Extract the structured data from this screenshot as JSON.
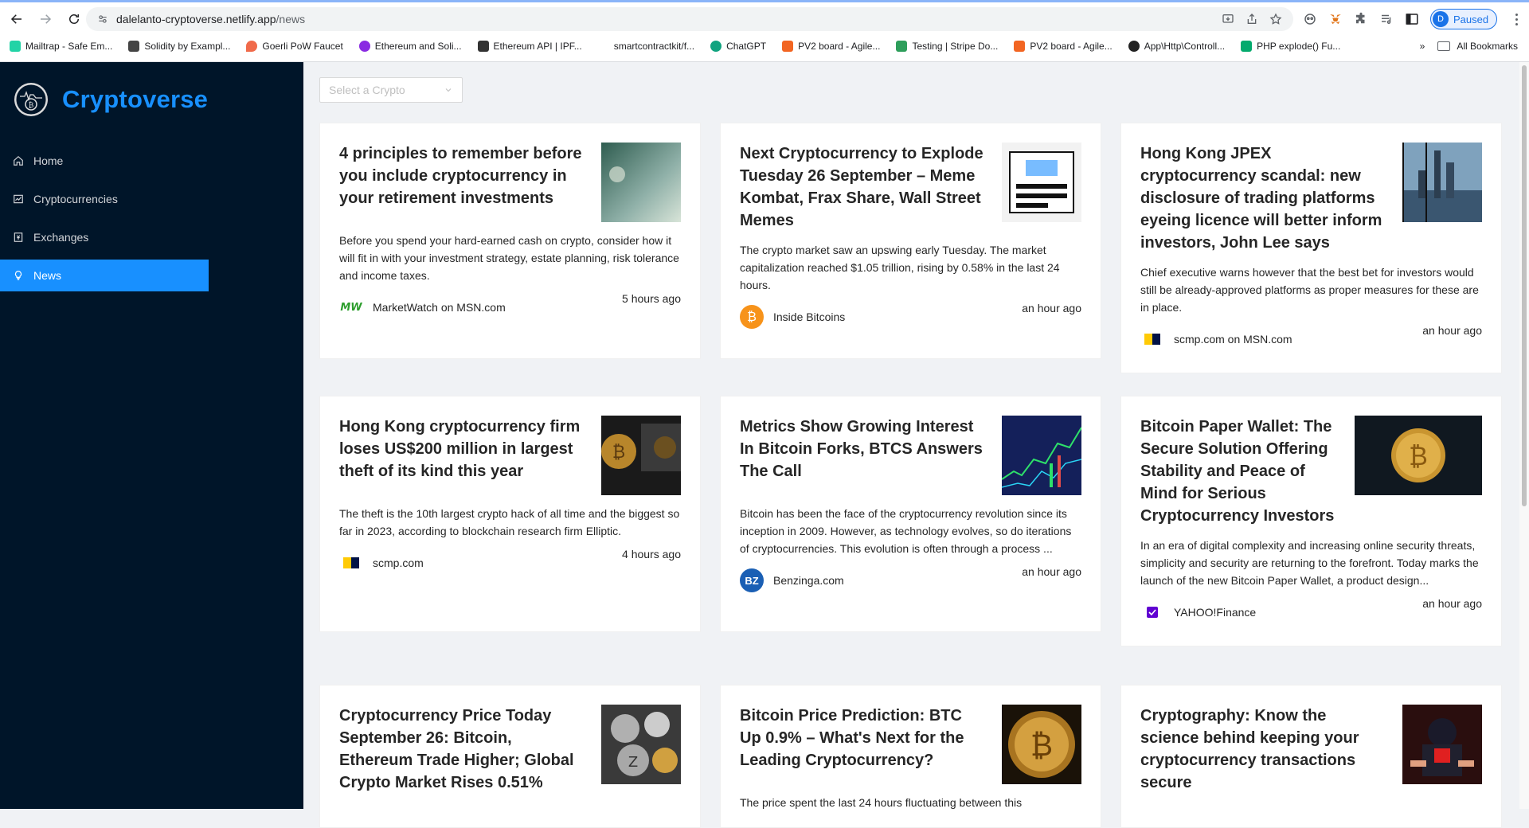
{
  "browser": {
    "url_host": "dalelanto-cryptoverse.netlify.app",
    "url_path": "/news",
    "profile_initial": "D",
    "profile_status": "Paused",
    "bookmarks": [
      {
        "label": "Mailtrap - Safe Em...",
        "color": "#22d3a6"
      },
      {
        "label": "Solidity by Exampl...",
        "color": "#444444"
      },
      {
        "label": "Goerli PoW Faucet",
        "color": "#f06a4a"
      },
      {
        "label": "Ethereum and Soli...",
        "color": "#8a2be2"
      },
      {
        "label": "Ethereum API | IPF...",
        "color": "#333333"
      },
      {
        "label": "smartcontractkit/f...",
        "color": "#ffffff"
      },
      {
        "label": "ChatGPT",
        "color": "#10a37f"
      },
      {
        "label": "PV2 board - Agile...",
        "color": "#f26522"
      },
      {
        "label": "Testing | Stripe Do...",
        "color": "#2e9e5b"
      },
      {
        "label": "PV2 board - Agile...",
        "color": "#f26522"
      },
      {
        "label": "App\\Http\\Controll...",
        "color": "#222222"
      },
      {
        "label": "PHP explode() Fu...",
        "color": "#04aa6d"
      }
    ],
    "all_bookmarks": "All Bookmarks",
    "overflow": "»"
  },
  "app": {
    "title": "Cryptoverse",
    "menu": [
      {
        "label": "Home",
        "icon": "home-icon"
      },
      {
        "label": "Cryptocurrencies",
        "icon": "fund-icon"
      },
      {
        "label": "Exchanges",
        "icon": "money-collect-icon"
      },
      {
        "label": "News",
        "icon": "bulb-icon",
        "active": true
      }
    ],
    "select_placeholder": "Select a Crypto"
  },
  "news": [
    {
      "headline": "4 principles to remember before you include cryptocurrency in your retirement investments",
      "description": "Before you spend your hard-earned cash on crypto, consider how it will fit in with your investment strategy, estate planning, risk tolerance and income taxes.",
      "provider": "MarketWatch on MSN.com",
      "time": "5 hours ago",
      "thumb_color": "#6b8f8c"
    },
    {
      "headline": "Next Cryptocurrency to Explode Tuesday 26 September – Meme Kombat, Frax Share, Wall Street Memes",
      "description": "The crypto market saw an upswing early Tuesday. The market capitalization reached $1.05 trillion, rising by 0.58% in the last 24 hours.",
      "provider": "Inside Bitcoins",
      "time": "an hour ago",
      "thumb_color": "#e8e8e8"
    },
    {
      "headline": "Hong Kong JPEX cryptocurrency scandal: new disclosure of trading platforms eyeing licence will better inform investors, John Lee says",
      "description": "Chief executive warns however that the best bet for investors would still be already-approved platforms as proper measures for these are in place.",
      "provider": "scmp.com on MSN.com",
      "time": "an hour ago",
      "thumb_color": "#4a6b85"
    },
    {
      "headline": "Hong Kong cryptocurrency firm loses US$200 million in largest theft of its kind this year",
      "description": "The theft is the 10th largest crypto hack of all time and the biggest so far in 2023, according to blockchain research firm Elliptic.",
      "provider": "scmp.com",
      "time": "4 hours ago",
      "thumb_color": "#2a2a2a"
    },
    {
      "headline": "Metrics Show Growing Interest In Bitcoin Forks, BTCS Answers The Call",
      "description": "Bitcoin has been the face of the cryptocurrency revolution since its inception in 2009. However, as technology evolves, so do iterations of cryptocurrencies. This evolution is often through a process ...",
      "provider": "Benzinga.com",
      "time": "an hour ago",
      "thumb_color": "#1a2a6b"
    },
    {
      "headline": "Bitcoin Paper Wallet: The Secure Solution Offering Stability and Peace of Mind for Serious Cryptocurrency Investors",
      "description": "In an era of digital complexity and increasing online security threats, simplicity and security are returning to the forefront. Today marks the launch of the new Bitcoin Paper Wallet, a product design...",
      "provider": "YAHOO!Finance",
      "time": "an hour ago",
      "thumb_color": "#1c2430"
    },
    {
      "headline": "Cryptocurrency Price Today September 26: Bitcoin, Ethereum Trade Higher; Global Crypto Market Rises 0.51%",
      "description": "",
      "provider": "",
      "time": "",
      "thumb_color": "#8a8a8a"
    },
    {
      "headline": "Bitcoin Price Prediction: BTC Up 0.9% – What's Next for the Leading Cryptocurrency?",
      "description": "The price spent the last 24 hours fluctuating between this",
      "provider": "",
      "time": "",
      "thumb_color": "#3a2a10"
    },
    {
      "headline": "Cryptography: Know the science behind keeping your cryptocurrency transactions secure",
      "description": "",
      "provider": "",
      "time": "",
      "thumb_color": "#4a1a1a"
    }
  ]
}
